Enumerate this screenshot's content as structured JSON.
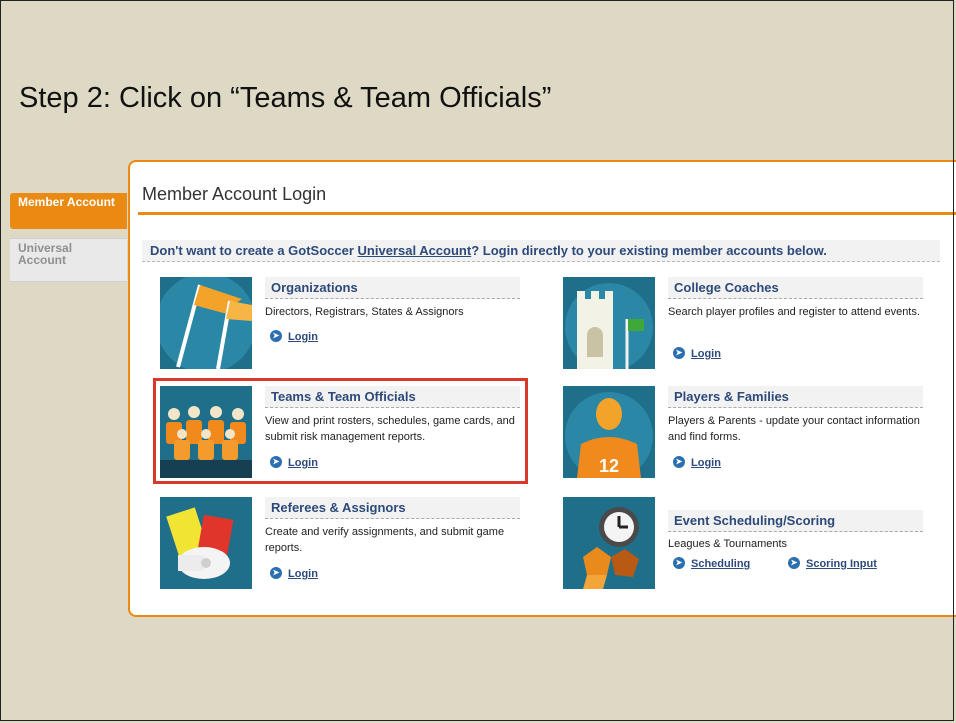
{
  "slide": {
    "title": "Step 2: Click on “Teams & Team Officials”"
  },
  "tabs": {
    "member": "Member Account",
    "universal": "Universal Account"
  },
  "panel": {
    "title": "Member Account Login",
    "intro_prefix": "Don't want to create a GotSoccer ",
    "intro_link": "Universal Account",
    "intro_suffix": "? Login directly to your existing member accounts below."
  },
  "cards": {
    "organizations": {
      "title": "Organizations",
      "desc": "Directors, Registrars, States & Assignors",
      "login": "Login"
    },
    "teams": {
      "title": "Teams & Team Officials",
      "desc": "View and print rosters, schedules, game cards, and submit risk management reports.",
      "login": "Login"
    },
    "referees": {
      "title": "Referees & Assignors",
      "desc": "Create and verify assignments, and submit game reports.",
      "login": "Login"
    },
    "college": {
      "title": "College Coaches",
      "desc": "Search player profiles and register to attend events.",
      "login": "Login"
    },
    "players": {
      "title": "Players & Families",
      "desc": "Players & Parents - update your contact information and find forms.",
      "login": "Login",
      "jersey_number": "12"
    },
    "events": {
      "title": "Event Scheduling/Scoring",
      "desc": "Leagues & Tournaments",
      "scheduling": "Scheduling",
      "scoring": "Scoring Input"
    }
  },
  "icons": {
    "organizations": "flags-icon",
    "teams": "team-officials-icon",
    "referees": "referee-cards-whistle-icon",
    "college": "college-building-icon",
    "players": "player-jersey-icon",
    "events": "clock-ball-icon",
    "login_arrow": "arrow-circle-icon"
  },
  "colors": {
    "accent": "#ea8a12",
    "link": "#2d4a7a",
    "highlight": "#d9392b",
    "thumb_bg": "#1f6e8a"
  }
}
